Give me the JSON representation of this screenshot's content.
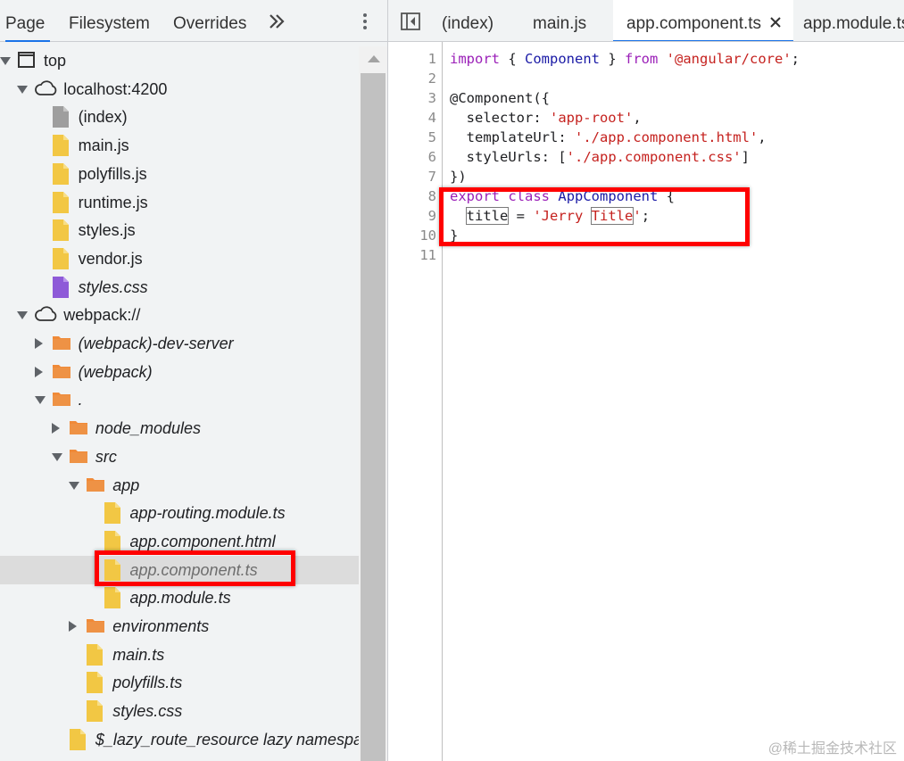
{
  "left_panel": {
    "tabs": [
      {
        "label": "Page",
        "active": true
      },
      {
        "label": "Filesystem",
        "active": false
      },
      {
        "label": "Overrides",
        "active": false
      }
    ],
    "more_tabs_icon": "double-chevron-right-icon",
    "menu_icon": "kebab-menu-icon",
    "tree": [
      {
        "label": "top",
        "depth": 0,
        "expander": "down",
        "icon": "frame",
        "italic": false
      },
      {
        "label": "localhost:4200",
        "depth": 1,
        "expander": "down",
        "icon": "cloud",
        "italic": false
      },
      {
        "label": "(index)",
        "depth": 2,
        "expander": "none",
        "icon": "file-gray",
        "italic": false
      },
      {
        "label": "main.js",
        "depth": 2,
        "expander": "none",
        "icon": "file-yellow",
        "italic": false
      },
      {
        "label": "polyfills.js",
        "depth": 2,
        "expander": "none",
        "icon": "file-yellow",
        "italic": false
      },
      {
        "label": "runtime.js",
        "depth": 2,
        "expander": "none",
        "icon": "file-yellow",
        "italic": false
      },
      {
        "label": "styles.js",
        "depth": 2,
        "expander": "none",
        "icon": "file-yellow",
        "italic": false
      },
      {
        "label": "vendor.js",
        "depth": 2,
        "expander": "none",
        "icon": "file-yellow",
        "italic": false
      },
      {
        "label": "styles.css",
        "depth": 2,
        "expander": "none",
        "icon": "file-purple",
        "italic": true
      },
      {
        "label": "webpack://",
        "depth": 1,
        "expander": "down",
        "icon": "cloud",
        "italic": false
      },
      {
        "label": "(webpack)-dev-server",
        "depth": 2,
        "expander": "right",
        "icon": "folder",
        "italic": true
      },
      {
        "label": "(webpack)",
        "depth": 2,
        "expander": "right",
        "icon": "folder",
        "italic": true
      },
      {
        "label": ".",
        "depth": 2,
        "expander": "down",
        "icon": "folder",
        "italic": true
      },
      {
        "label": "node_modules",
        "depth": 3,
        "expander": "right",
        "icon": "folder",
        "italic": true
      },
      {
        "label": "src",
        "depth": 3,
        "expander": "down",
        "icon": "folder",
        "italic": true
      },
      {
        "label": "app",
        "depth": 4,
        "expander": "down",
        "icon": "folder",
        "italic": true
      },
      {
        "label": "app-routing.module.ts",
        "depth": 5,
        "expander": "none",
        "icon": "file-yellow",
        "italic": true
      },
      {
        "label": "app.component.html",
        "depth": 5,
        "expander": "none",
        "icon": "file-yellow",
        "italic": true
      },
      {
        "label": "app.component.ts",
        "depth": 5,
        "expander": "none",
        "icon": "file-yellow",
        "italic": true,
        "selected": true
      },
      {
        "label": "app.module.ts",
        "depth": 5,
        "expander": "none",
        "icon": "file-yellow",
        "italic": true
      },
      {
        "label": "environments",
        "depth": 4,
        "expander": "right",
        "icon": "folder",
        "italic": true
      },
      {
        "label": "main.ts",
        "depth": 4,
        "expander": "none",
        "icon": "file-yellow",
        "italic": true
      },
      {
        "label": "polyfills.ts",
        "depth": 4,
        "expander": "none",
        "icon": "file-yellow",
        "italic": true
      },
      {
        "label": "styles.css",
        "depth": 4,
        "expander": "none",
        "icon": "file-yellow",
        "italic": true
      },
      {
        "label": "$_lazy_route_resource lazy namespa",
        "depth": 3,
        "expander": "none",
        "icon": "file-yellow",
        "italic": true
      }
    ]
  },
  "editor": {
    "navigator_toggle_icon": "toggle-navigator-icon",
    "tabs": [
      {
        "label": "(index)",
        "active": false
      },
      {
        "label": "main.js",
        "active": false
      },
      {
        "label": "app.component.ts",
        "active": true,
        "closable": true
      },
      {
        "label": "app.module.ts",
        "active": false
      }
    ],
    "close_icon": "close-icon",
    "line_numbers": [
      "1",
      "2",
      "3",
      "4",
      "5",
      "6",
      "7",
      "8",
      "9",
      "10",
      "11"
    ],
    "code_lines": [
      [
        {
          "t": "import",
          "c": "kw"
        },
        {
          "t": " { "
        },
        {
          "t": "Component",
          "c": "ty"
        },
        {
          "t": " } "
        },
        {
          "t": "from",
          "c": "kw"
        },
        {
          "t": " "
        },
        {
          "t": "'@angular/core'",
          "c": "str"
        },
        {
          "t": ";"
        }
      ],
      [],
      [
        {
          "t": "@Component({"
        }
      ],
      [
        {
          "t": "  selector: "
        },
        {
          "t": "'app-root'",
          "c": "str"
        },
        {
          "t": ","
        }
      ],
      [
        {
          "t": "  templateUrl: "
        },
        {
          "t": "'./app.component.html'",
          "c": "str"
        },
        {
          "t": ","
        }
      ],
      [
        {
          "t": "  styleUrls: ["
        },
        {
          "t": "'./app.component.css'",
          "c": "str"
        },
        {
          "t": "]"
        }
      ],
      [
        {
          "t": "})"
        }
      ],
      [
        {
          "t": "export",
          "c": "kw"
        },
        {
          "t": " "
        },
        {
          "t": "class",
          "c": "kw"
        },
        {
          "t": " "
        },
        {
          "t": "AppComponent",
          "c": "ty"
        },
        {
          "t": " {"
        }
      ],
      [
        {
          "t": "  "
        },
        {
          "t": "title",
          "b": true
        },
        {
          "t": " = "
        },
        {
          "t": "'Jerry ",
          "c": "str"
        },
        {
          "t": "Title",
          "c": "str",
          "b": true
        },
        {
          "t": "'",
          "c": "str"
        },
        {
          "t": ";"
        }
      ],
      [
        {
          "t": "}"
        }
      ],
      []
    ]
  },
  "watermark": "@稀土掘金技术社区",
  "colors": {
    "annotation_box": "#ff0000",
    "active_tab_underline": "#1a73e8",
    "keyword": "#9b20b8",
    "string": "#c5221f",
    "type": "#1a1aa6"
  }
}
